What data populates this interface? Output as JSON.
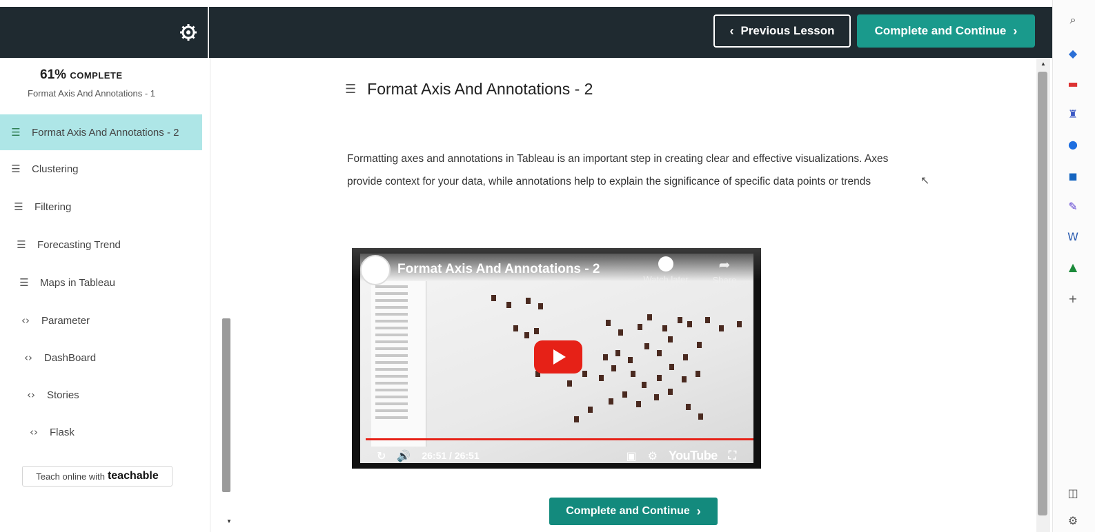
{
  "topbar": {
    "prev_label": "Previous Lesson",
    "next_label": "Complete and Continue",
    "settings_icon": "gear-icon"
  },
  "sidebar": {
    "progress_percent": "61%",
    "progress_label": "COMPLETE",
    "partial_item": "Format Axis And Annotations - 1",
    "items": [
      {
        "label": "Format Axis And Annotations - 2",
        "icon": "document-icon",
        "active": true
      },
      {
        "label": "Clustering",
        "icon": "checklist-icon"
      },
      {
        "label": "Filtering",
        "icon": "checklist-icon"
      },
      {
        "label": "Forecasting Trend",
        "icon": "checklist-icon"
      },
      {
        "label": "Maps in Tableau",
        "icon": "checklist-icon"
      },
      {
        "label": "Parameter",
        "icon": "code-icon"
      },
      {
        "label": "DashBoard",
        "icon": "code-icon"
      },
      {
        "label": "Stories",
        "icon": "code-icon"
      },
      {
        "label": "Flask",
        "icon": "code-icon"
      }
    ],
    "teach_prefix": "Teach online with",
    "teach_brand": "teachable"
  },
  "main": {
    "title": "Format Axis And Annotations - 2",
    "description": "Formatting axes and annotations in Tableau is an important step in creating clear and effective visualizations. Axes provide context for your data, while annotations help to explain the significance of specific data points or trends",
    "video": {
      "title": "Format Axis And Annotations - 2",
      "watch_later": "Watch later",
      "share": "Share",
      "time": "26:51 / 26:51",
      "brand": "YouTube",
      "progress": 1.0
    },
    "bottom_button": "Complete and Continue"
  },
  "colors": {
    "topbar_bg": "#1f2a30",
    "accent": "#1a9a8c",
    "active_item_bg": "#aee6e7",
    "youtube_red": "#e62117"
  }
}
